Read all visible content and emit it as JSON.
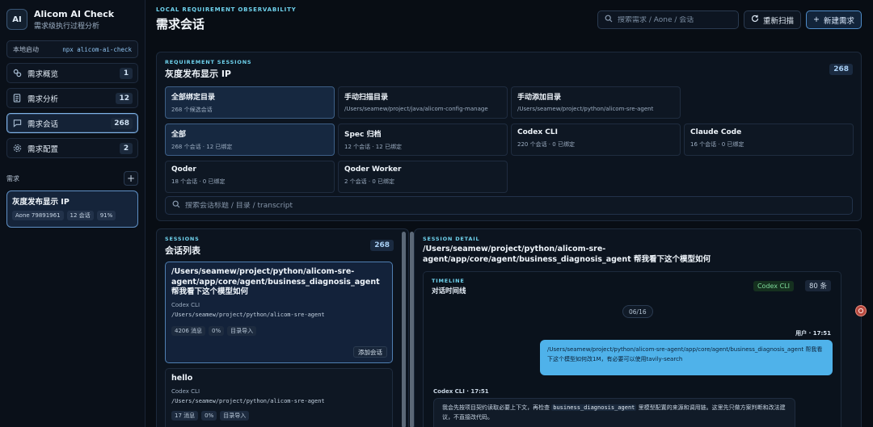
{
  "brand": {
    "logo": "AI",
    "title": "Alicom AI Check",
    "subtitle": "需求级执行过程分析"
  },
  "launch": {
    "label": "本地启动",
    "command": "npx alicom-ai-check"
  },
  "nav": [
    {
      "label": "需求概览",
      "count": "1",
      "icon": "link-icon"
    },
    {
      "label": "需求分析",
      "count": "12",
      "icon": "document-icon"
    },
    {
      "label": "需求会话",
      "count": "268",
      "icon": "chat-icon",
      "active": true
    },
    {
      "label": "需求配置",
      "count": "2",
      "icon": "gear-icon"
    }
  ],
  "requirements": {
    "section_label": "需求",
    "add_label": "+",
    "card": {
      "title": "灰度发布显示 IP",
      "tags": [
        "Aone 79891961",
        "12 会话",
        "91%"
      ]
    }
  },
  "header": {
    "eyebrow": "LOCAL REQUIREMENT OBSERVABILITY",
    "title": "需求会话",
    "search_placeholder": "搜索需求 / Aone / 会话",
    "rescan_label": "重新扫描",
    "new_label": "新建需求"
  },
  "sessions_panel": {
    "eyebrow": "REQUIREMENT SESSIONS",
    "title": "灰度发布显示 IP",
    "count": "268",
    "cards": [
      {
        "title": "全部绑定目录",
        "sub": "268 个候选会话",
        "active": true
      },
      {
        "title": "手动扫描目录",
        "sub": "/Users/seamew/project/java/alicom-config-manage"
      },
      {
        "title": "手动添加目录",
        "sub": "/Users/seamew/project/python/alicom-sre-agent"
      },
      {
        "title": "",
        "sub": ""
      },
      {
        "title": "全部",
        "sub": "268 个会话 · 12 已绑定",
        "active": true
      },
      {
        "title": "Spec 归档",
        "sub": "12 个会话 · 12 已绑定"
      },
      {
        "title": "Codex CLI",
        "sub": "220 个会话 · 0 已绑定"
      },
      {
        "title": "Claude Code",
        "sub": "16 个会话 · 0 已绑定"
      },
      {
        "title": "Qoder",
        "sub": "18 个会话 · 0 已绑定"
      },
      {
        "title": "Qoder Worker",
        "sub": "2 个会话 · 0 已绑定"
      }
    ],
    "search_placeholder": "搜索会话标题 / 目录 / transcript"
  },
  "session_list": {
    "eyebrow": "SESSIONS",
    "title": "会话列表",
    "count": "268",
    "items": [
      {
        "title": "/Users/seamew/project/python/alicom-sre-agent/app/core/agent/business_diagnosis_agent 帮我看下这个模型如何",
        "tool": "Codex CLI",
        "path": "/Users/seamew/project/python/alicom-sre-agent",
        "tags": [
          "4206 消息",
          "0%",
          "目录导入"
        ],
        "add_label": "添加会话"
      },
      {
        "title": "hello",
        "tool": "Codex CLI",
        "path": "/Users/seamew/project/python/alicom-sre-agent",
        "tags": [
          "17 消息",
          "0%",
          "目录导入"
        ]
      }
    ]
  },
  "detail": {
    "eyebrow": "SESSION DETAIL",
    "title": "/Users/seamew/project/python/alicom-sre-agent/app/core/agent/business_diagnosis_agent 帮我看下这个模型如何",
    "timeline": {
      "eyebrow": "TIMELINE",
      "title": "对话时间线",
      "tool": "Codex CLI",
      "count": "80 条",
      "date": "06/16",
      "user_meta": "用户 · 17:51",
      "user_message": "/Users/seamew/project/python/alicom-sre-agent/app/core/agent/business_diagnosis_agent 帮我看下这个模型如何改1M，有必要可以使用tavily-search",
      "assistant_meta": "Codex CLI · 17:51",
      "assistant_pre": "我会先按项目契约读取必要上下文，再检查 ",
      "assistant_code": "business_diagnosis_agent",
      "assistant_post": " 里模型配置的来源和调用链。这里先只做方案判断和改法建议，不直接改代码。"
    }
  },
  "colors": {
    "accent": "#6fd3ee",
    "bubble": "#4fb2ea",
    "tool_green": "#7fdc9c"
  }
}
